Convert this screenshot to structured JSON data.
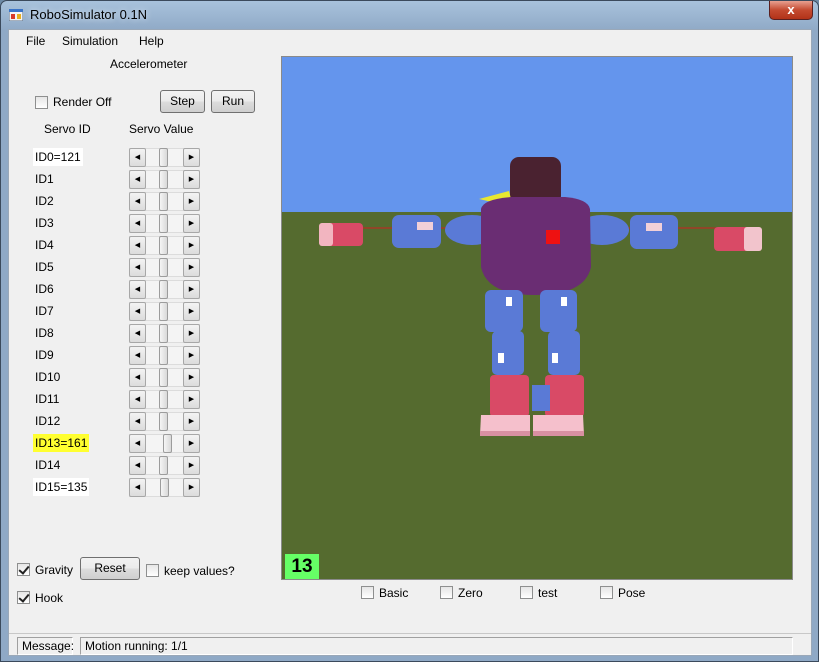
{
  "window": {
    "title": "RoboSimulator 0.1N",
    "close_glyph": "x"
  },
  "menu": [
    "File",
    "Simulation",
    "Help"
  ],
  "panel": {
    "title": "Accelerometer",
    "render_off_label": "Render Off",
    "render_off_checked": false,
    "step_label": "Step",
    "run_label": "Run",
    "col_servo_id": "Servo ID",
    "col_servo_value": "Servo Value"
  },
  "servos": [
    {
      "label": "ID0=121",
      "style": "boxed",
      "value": 0.45
    },
    {
      "label": "ID1",
      "style": "plain",
      "value": 0.45
    },
    {
      "label": "ID2",
      "style": "plain",
      "value": 0.45
    },
    {
      "label": "ID3",
      "style": "plain",
      "value": 0.45
    },
    {
      "label": "ID4",
      "style": "plain",
      "value": 0.45
    },
    {
      "label": "ID5",
      "style": "plain",
      "value": 0.45
    },
    {
      "label": "ID6",
      "style": "plain",
      "value": 0.45
    },
    {
      "label": "ID7",
      "style": "plain",
      "value": 0.45
    },
    {
      "label": "ID8",
      "style": "plain",
      "value": 0.45
    },
    {
      "label": "ID9",
      "style": "plain",
      "value": 0.45
    },
    {
      "label": "ID10",
      "style": "plain",
      "value": 0.45
    },
    {
      "label": "ID11",
      "style": "plain",
      "value": 0.45
    },
    {
      "label": "ID12",
      "style": "plain",
      "value": 0.45
    },
    {
      "label": "ID13=161",
      "style": "highlight",
      "value": 0.6
    },
    {
      "label": "ID14",
      "style": "plain",
      "value": 0.45
    },
    {
      "label": "ID15=135",
      "style": "boxed",
      "value": 0.5
    }
  ],
  "bottom": {
    "gravity_label": "Gravity",
    "gravity_checked": true,
    "hook_label": "Hook",
    "hook_checked": true,
    "reset_label": "Reset",
    "keep_label": "keep values?",
    "keep_checked": false
  },
  "viewport": {
    "frame_number": "13",
    "sky_color": "#6495ed",
    "ground_color": "#556b2f"
  },
  "poses": [
    {
      "label": "Basic",
      "checked": false
    },
    {
      "label": "Zero",
      "checked": false
    },
    {
      "label": "test",
      "checked": false
    },
    {
      "label": "Pose",
      "checked": false
    }
  ],
  "status": {
    "message_label": "Message:",
    "message_text": "Motion running: 1/1"
  }
}
